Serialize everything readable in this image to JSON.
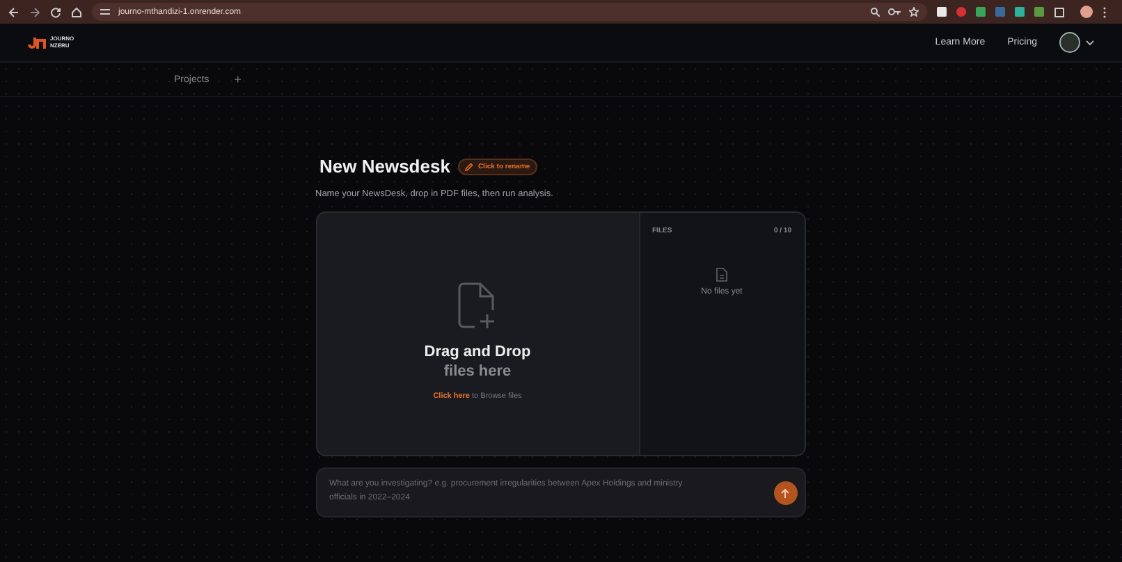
{
  "browser": {
    "url": "journo-mthandizi-1.onrender.com"
  },
  "header": {
    "logo_text": "JOURNO NZERU",
    "nav": [
      "Learn More",
      "Pricing"
    ]
  },
  "subbar": {
    "tab": "Projects",
    "add": "+"
  },
  "newsdesk": {
    "title": "New Newsdesk",
    "rename": "Click to rename",
    "subtitle": "Name your NewsDesk, drop in PDF files, then run analysis."
  },
  "dropzone": {
    "title": "Drag and Drop",
    "subtitle": "files here",
    "link": "Click here",
    "rest": "to Browse files"
  },
  "files": {
    "heading": "FILES",
    "count": "0 / 10",
    "empty": "No files yet"
  },
  "prompt": {
    "placeholder": "What are you investigating? e.g. procurement irregularities between Apex Holdings and ministry officials in 2022–2024"
  }
}
